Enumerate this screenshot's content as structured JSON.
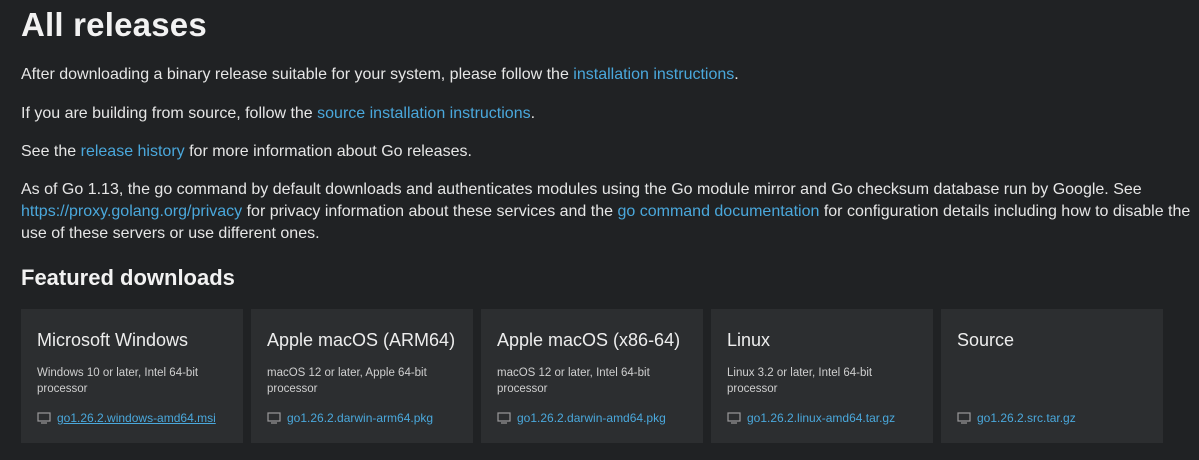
{
  "page": {
    "title": "All releases",
    "intro_1": {
      "before": "After downloading a binary release suitable for your system, please follow the ",
      "link": "installation instructions",
      "after": "."
    },
    "intro_2": {
      "before": "If you are building from source, follow the ",
      "link": "source installation instructions",
      "after": "."
    },
    "intro_3": {
      "before": "See the ",
      "link": "release history",
      "after": " for more information about Go releases."
    },
    "intro_4": {
      "before": "As of Go 1.13, the go command by default downloads and authenticates modules using the Go module mirror and Go checksum database run by Google. See ",
      "link1": "https://proxy.golang.org/privacy",
      "middle": " for privacy information about these services and the ",
      "link2": "go command documentation",
      "after": " for configuration details including how to disable the use of these servers or use different ones."
    }
  },
  "featured": {
    "heading": "Featured downloads",
    "cards": [
      {
        "title": "Microsoft Windows",
        "desc": "Windows 10 or later, Intel 64-bit processor",
        "file": "go1.26.2.windows-amd64.msi"
      },
      {
        "title": "Apple macOS (ARM64)",
        "desc": "macOS 12 or later, Apple 64-bit processor",
        "file": "go1.26.2.darwin-arm64.pkg"
      },
      {
        "title": "Apple macOS (x86-64)",
        "desc": "macOS 12 or later, Intel 64-bit processor",
        "file": "go1.26.2.darwin-amd64.pkg"
      },
      {
        "title": "Linux",
        "desc": "Linux 3.2 or later, Intel 64-bit processor",
        "file": "go1.26.2.linux-amd64.tar.gz"
      },
      {
        "title": "Source",
        "desc": "",
        "file": "go1.26.2.src.tar.gz"
      }
    ]
  },
  "colors": {
    "background": "#202224",
    "card": "#2c2e30",
    "link": "#4aa8dc",
    "text": "#e6e6e6"
  },
  "icons": {
    "download": "download-icon"
  }
}
